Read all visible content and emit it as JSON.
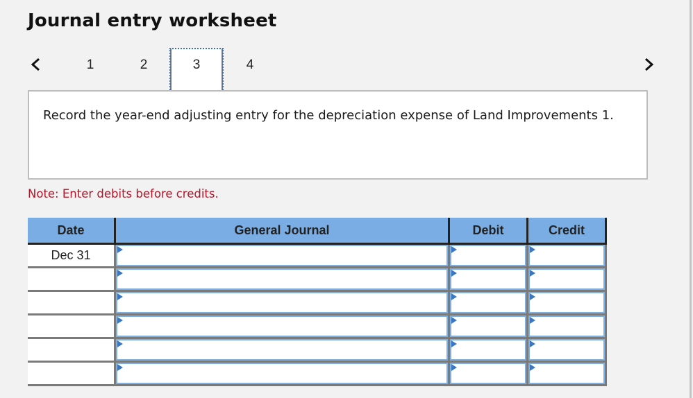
{
  "title": "Journal entry worksheet",
  "navigation": {
    "prev_icon": "chevron-left-icon",
    "next_icon": "chevron-right-icon",
    "tabs": [
      {
        "label": "1",
        "active": false
      },
      {
        "label": "2",
        "active": false
      },
      {
        "label": "3",
        "active": true
      },
      {
        "label": "4",
        "active": false
      }
    ]
  },
  "prompt": "Record the year-end adjusting entry for the depreciation expense of Land Improvements 1.",
  "note": "Note: Enter debits before credits.",
  "table": {
    "headers": {
      "date": "Date",
      "general_journal": "General Journal",
      "debit": "Debit",
      "credit": "Credit"
    },
    "rows": [
      {
        "date": "Dec 31",
        "account": "",
        "debit": "",
        "credit": ""
      },
      {
        "date": "",
        "account": "",
        "debit": "",
        "credit": ""
      },
      {
        "date": "",
        "account": "",
        "debit": "",
        "credit": ""
      },
      {
        "date": "",
        "account": "",
        "debit": "",
        "credit": ""
      },
      {
        "date": "",
        "account": "",
        "debit": "",
        "credit": ""
      },
      {
        "date": "",
        "account": "",
        "debit": "",
        "credit": ""
      }
    ]
  },
  "colors": {
    "header_bg": "#7aade3",
    "note_text": "#b0182a",
    "input_border": "#7fb0e4",
    "marker": "#3b78c3"
  }
}
